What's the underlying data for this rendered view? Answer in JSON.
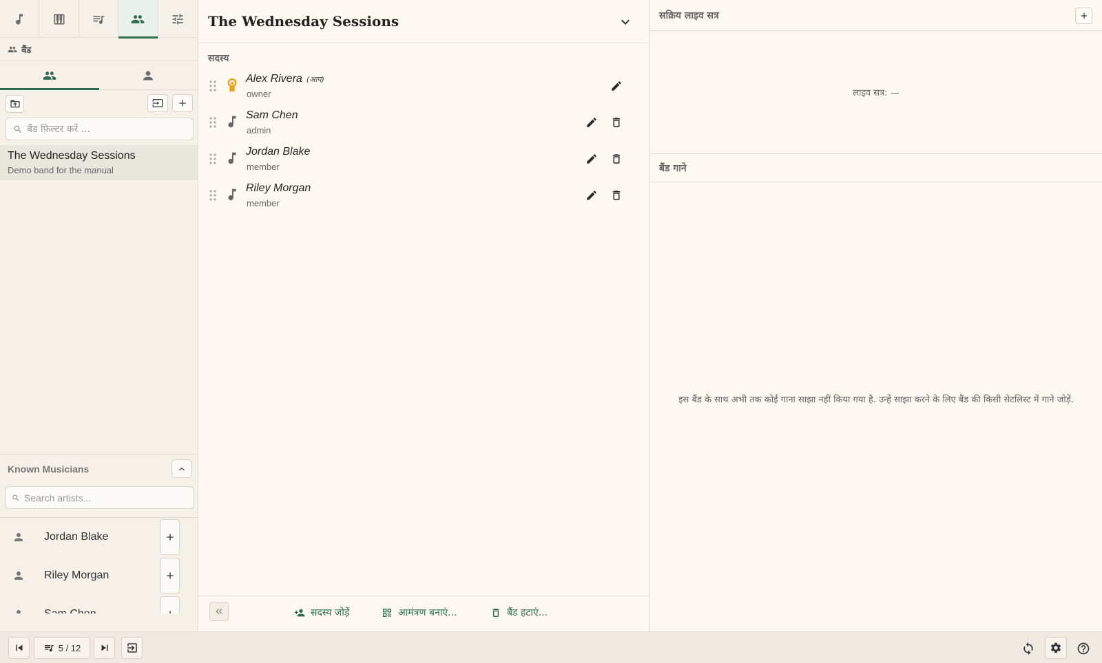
{
  "left": {
    "section_title": "बैंड",
    "band_filter_placeholder": "बैंड फ़िल्टर करें ...",
    "bands": [
      {
        "name": "The Wednesday Sessions",
        "description": "Demo band for the manual"
      }
    ],
    "known_musicians": {
      "title": "Known Musicians",
      "search_placeholder": "Search artists...",
      "items": [
        {
          "name": "Jordan Blake"
        },
        {
          "name": "Riley Morgan"
        },
        {
          "name": "Sam Chen"
        }
      ]
    }
  },
  "middle": {
    "band_title": "The Wednesday Sessions",
    "members_label": "सदस्य",
    "you_tag": "(आप)",
    "members": [
      {
        "name": "Alex Rivera",
        "role": "owner"
      },
      {
        "name": "Sam Chen",
        "role": "admin"
      },
      {
        "name": "Jordan Blake",
        "role": "member"
      },
      {
        "name": "Riley Morgan",
        "role": "member"
      }
    ],
    "footer": {
      "add_member": "सदस्य जोड़ें",
      "create_invite": "आमंत्रण बनाएं...",
      "delete_band": "बैंड हटाएं..."
    }
  },
  "right": {
    "live_sessions_title": "सक्रिय लाइव सत्र",
    "live_session_status": "लाइव सत्र: —",
    "band_songs_title": "बैंड गाने",
    "band_songs_empty": "इस बैंड के साथ अभी तक कोई गाना साझा नहीं किया गया है. उन्हें साझा करने के लिए बैंड की किसी सेटलिस्ट में गाने जोड़ें."
  },
  "bottom_bar": {
    "setlist_position": "5 / 12"
  },
  "colors": {
    "accent": "#2f6b4f",
    "owner_badge": "#e9a21c",
    "background": "#fdf8f1"
  }
}
